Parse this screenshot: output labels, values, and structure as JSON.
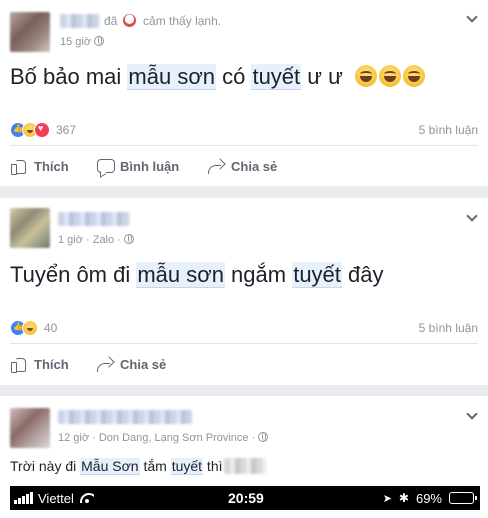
{
  "posts": [
    {
      "feeling_prefix": "đã",
      "feeling_text": "cảm thấy lạnh.",
      "time": "15 giờ",
      "text_parts": [
        "Bố bảo mai ",
        "mẫu sơn",
        " có ",
        "tuyết",
        " ư ư"
      ],
      "reaction_count": "367",
      "comments": "5 bình luận",
      "actions": {
        "like": "Thích",
        "comment": "Bình luận",
        "share": "Chia sẻ"
      }
    },
    {
      "time": "1 giờ · Zalo ·",
      "text_parts": [
        "Tuyển ôm đi ",
        "mẫu sơn",
        " ngắm ",
        "tuyết",
        " đây"
      ],
      "reaction_count": "40",
      "comments": "5 bình luận",
      "actions": {
        "like": "Thích",
        "share": "Chia sẻ"
      }
    },
    {
      "time": "12 giờ · Don Dang, Lạng Sơn Province ·",
      "text_parts": [
        "Trời này đi ",
        "Mẫu Sơn",
        " tắm ",
        "tuyết",
        " thì"
      ]
    }
  ],
  "statusbar": {
    "carrier": "Viettel",
    "time": "20:59",
    "battery": "69%",
    "battery_level": 0.69
  }
}
